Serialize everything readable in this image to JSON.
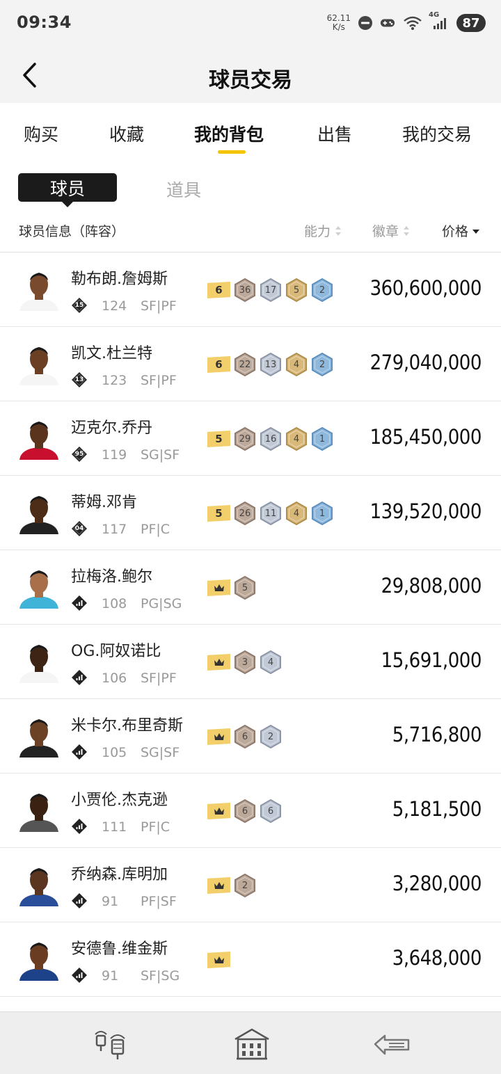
{
  "status_bar": {
    "time": "09:34",
    "net_speed_value": "62.11",
    "net_speed_unit": "K/s",
    "network": "4G",
    "battery": "87"
  },
  "header": {
    "title": "球员交易"
  },
  "main_tabs": [
    {
      "label": "购买"
    },
    {
      "label": "收藏"
    },
    {
      "label": "我的背包",
      "active": true
    },
    {
      "label": "出售"
    },
    {
      "label": "我的交易"
    }
  ],
  "sub_tabs": [
    {
      "label": "球员",
      "active": true
    },
    {
      "label": "道具"
    }
  ],
  "columns": {
    "info": "球员信息（阵容）",
    "ability": "能力",
    "badges": "徽章",
    "price": "价格"
  },
  "colors": {
    "accent": "#f5c400",
    "tier_gold": "#f2cf6a",
    "hex_bronze": "#bda99a",
    "hex_silver": "#c2c9d6",
    "hex_gold": "#d9b97a",
    "hex_blue": "#8fb8dd"
  },
  "players": [
    {
      "name": "勒布朗.詹姆斯",
      "rank_icon": "diamond-badge",
      "rank": "15",
      "rating": "124",
      "pos": "SF|PF",
      "tier": "6",
      "badges": [
        "36",
        "17",
        "5",
        "2"
      ],
      "price": "360,600,000"
    },
    {
      "name": "凯文.杜兰特",
      "rank_icon": "diamond-badge",
      "rank": "13",
      "rating": "123",
      "pos": "SF|PF",
      "tier": "6",
      "badges": [
        "22",
        "13",
        "4",
        "2"
      ],
      "price": "279,040,000"
    },
    {
      "name": "迈克尔.乔丹",
      "rank_icon": "diamond-badge",
      "rank": "95",
      "rating": "119",
      "pos": "SG|SF",
      "tier": "5",
      "badges": [
        "29",
        "16",
        "4",
        "1"
      ],
      "price": "185,450,000"
    },
    {
      "name": "蒂姆.邓肯",
      "rank_icon": "diamond-badge",
      "rank": "04",
      "rating": "117",
      "pos": "PF|C",
      "tier": "5",
      "badges": [
        "26",
        "11",
        "4",
        "1"
      ],
      "price": "139,520,000"
    },
    {
      "name": "拉梅洛.鲍尔",
      "rank_icon": "signal-badge",
      "rank": "",
      "rating": "108",
      "pos": "PG|SG",
      "tier": "crown",
      "badges": [
        "5"
      ],
      "price": "29,808,000"
    },
    {
      "name": "OG.阿奴诺比",
      "rank_icon": "signal-badge",
      "rank": "",
      "rating": "106",
      "pos": "SF|PF",
      "tier": "crown",
      "badges": [
        "3",
        "4"
      ],
      "price": "15,691,000"
    },
    {
      "name": "米卡尔.布里奇斯",
      "rank_icon": "signal-badge",
      "rank": "",
      "rating": "105",
      "pos": "SG|SF",
      "tier": "crown",
      "badges": [
        "6",
        "2"
      ],
      "price": "5,716,800"
    },
    {
      "name": "小贾伦.杰克逊",
      "rank_icon": "signal-badge",
      "rank": "",
      "rating": "111",
      "pos": "PF|C",
      "tier": "crown",
      "badges": [
        "6",
        "6"
      ],
      "price": "5,181,500"
    },
    {
      "name": "乔纳森.库明加",
      "rank_icon": "signal-badge",
      "rank": "",
      "rating": "91",
      "pos": "PF|SF",
      "tier": "crown",
      "badges": [
        "2"
      ],
      "price": "3,280,000"
    },
    {
      "name": "安德鲁.维金斯",
      "rank_icon": "signal-badge",
      "rank": "",
      "rating": "91",
      "pos": "SF|SG",
      "tier": "crown",
      "badges": [],
      "price": "3,648,000"
    }
  ],
  "bottom_nav": [
    {
      "icon": "lanterns-icon"
    },
    {
      "icon": "building-icon"
    },
    {
      "icon": "arrow-sign-icon"
    }
  ]
}
